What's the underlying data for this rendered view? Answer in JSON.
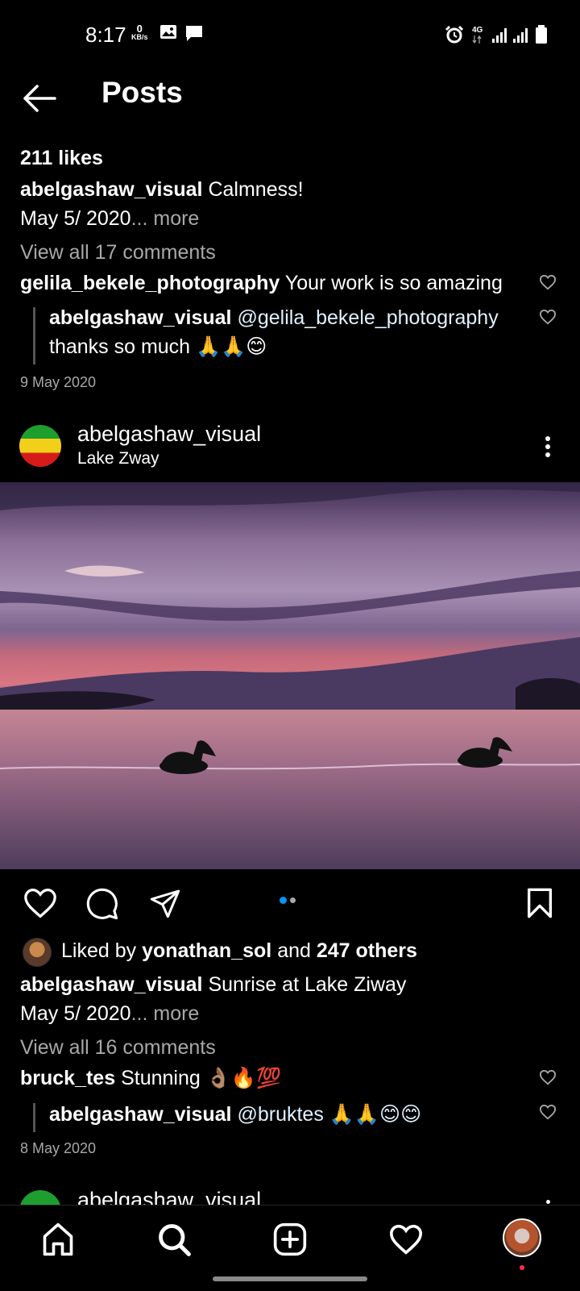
{
  "status_bar": {
    "time": "8:17",
    "net_speed_value": "0",
    "net_speed_unit": "KB/s",
    "network": "4G"
  },
  "header": {
    "title": "Posts"
  },
  "post1": {
    "likes": "211 likes",
    "caption_user": "abelgashaw_visual",
    "caption_text": "Calmness!",
    "caption_line2": "May 5/ 2020",
    "more": "... more",
    "view_comments": "View all 17 comments",
    "comment_user": "gelila_bekele_photography",
    "comment_text": "Your work is so amazing",
    "reply_user": "abelgashaw_visual",
    "reply_mention": "@gelila_bekele_photography",
    "reply_text": "thanks so much 🙏🙏😊",
    "date": "9 May 2020"
  },
  "post2": {
    "username": "abelgashaw_visual",
    "location": "Lake Zway",
    "carousel_pages": 2,
    "carousel_active": 1,
    "liked_by_prefix": "Liked by",
    "liked_by_user": "yonathan_sol",
    "liked_by_and": "and",
    "liked_by_others": "247 others",
    "caption_user": "abelgashaw_visual",
    "caption_text": "Sunrise at Lake Ziway",
    "caption_line2": "May 5/ 2020",
    "more": "... more",
    "view_comments": "View all 16 comments",
    "comment_user": "bruck_tes",
    "comment_text": "Stunning 👌🏽🔥💯",
    "reply_user": "abelgashaw_visual",
    "reply_text": "@bruktes 🙏🙏😊😊",
    "date": "8 May 2020"
  },
  "post3": {
    "username": "abelgashaw_visual"
  },
  "colors": {
    "background": "#000000",
    "text": "#ffffff",
    "secondary": "#a8a8a8",
    "mention": "#e0f1ff",
    "accent": "#0095f6",
    "notification_dot": "#ff3040"
  },
  "nav": [
    "home-icon",
    "search-icon",
    "add-post-icon",
    "activity-heart-icon",
    "profile-avatar"
  ]
}
